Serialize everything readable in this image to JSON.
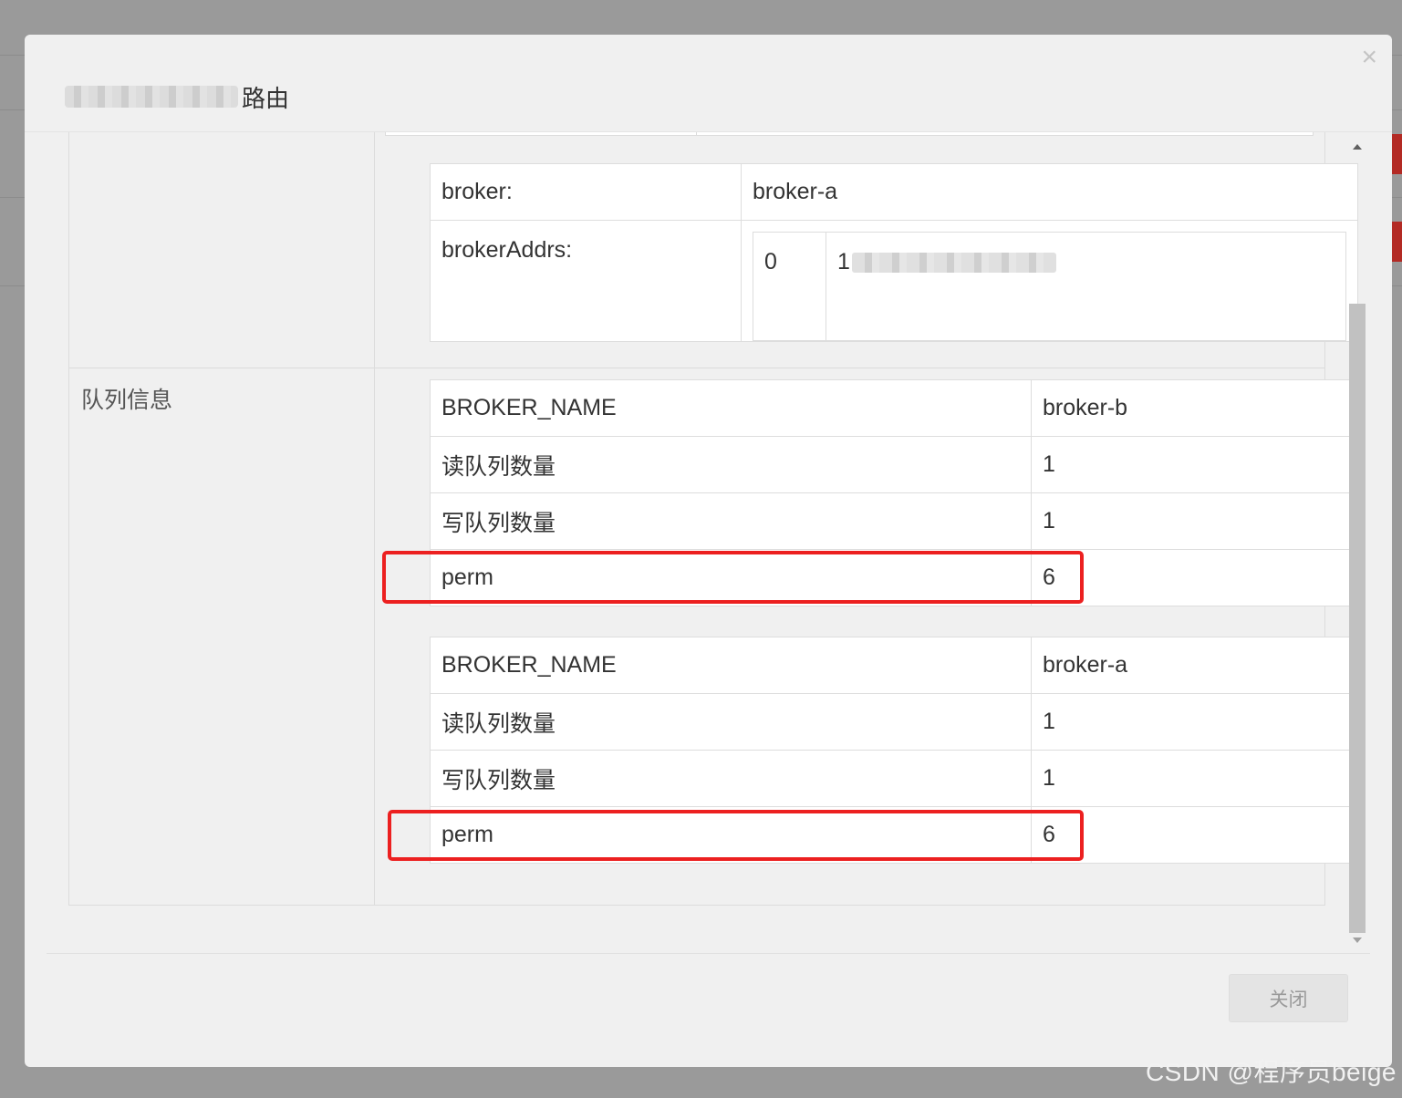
{
  "modal": {
    "title_suffix": "路由",
    "close_icon": "×",
    "close_button_label": "关闭"
  },
  "route": {
    "broker_label": "broker:",
    "broker_value": "broker-a",
    "broker_addrs_label": "brokerAddrs:",
    "broker_addrs": [
      {
        "id": "0",
        "addr_prefix": "1"
      }
    ]
  },
  "queue_section_label": "队列信息",
  "queues": [
    {
      "name_label": "BROKER_NAME",
      "name_value": "broker-b",
      "read_label": "读队列数量",
      "read_value": "1",
      "write_label": "写队列数量",
      "write_value": "1",
      "perm_label": "perm",
      "perm_value": "6"
    },
    {
      "name_label": "BROKER_NAME",
      "name_value": "broker-a",
      "read_label": "读队列数量",
      "read_value": "1",
      "write_label": "写队列数量",
      "write_value": "1",
      "perm_label": "perm",
      "perm_value": "6"
    }
  ],
  "watermark": "CSDN @程序员beige"
}
